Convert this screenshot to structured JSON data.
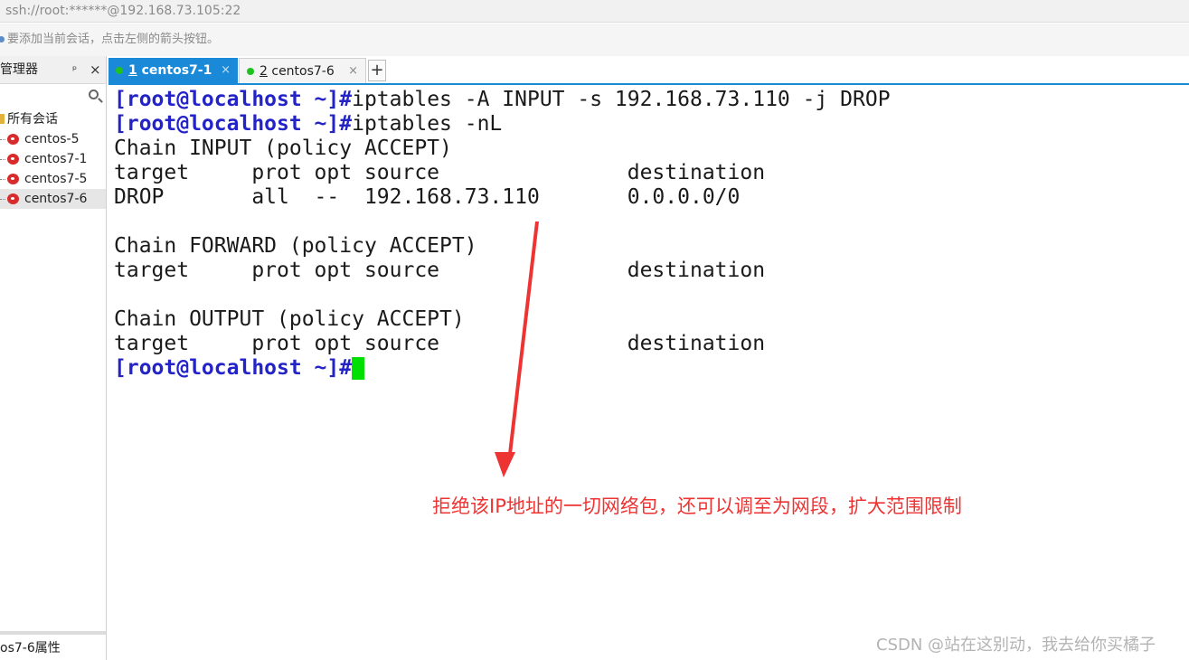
{
  "window": {
    "address": "ssh://root:******@192.168.73.105:22",
    "hint": "要添加当前会话，点击左侧的箭头按钮。"
  },
  "sidebar": {
    "title": "管理器",
    "pin_glyph": "ᵖ",
    "close_glyph": "×",
    "root_label": "所有会话",
    "items": [
      {
        "label": "centos-5"
      },
      {
        "label": "centos7-1"
      },
      {
        "label": "centos7-5"
      },
      {
        "label": "centos7-6"
      }
    ],
    "selected_item": "centos7-6",
    "properties_label": "os7-6属性"
  },
  "tabs": [
    {
      "number": "1",
      "label": " centos7-1",
      "close": "×",
      "active": true
    },
    {
      "number": "2",
      "label": " centos7-6",
      "close": "×",
      "active": false
    }
  ],
  "add_tab_label": "+",
  "terminal": {
    "lines": [
      {
        "prompt": "[root@localhost ~]#",
        "text": "iptables -A INPUT -s 192.168.73.110 -j DROP"
      },
      {
        "prompt": "[root@localhost ~]#",
        "text": "iptables -nL"
      },
      {
        "text": "Chain INPUT (policy ACCEPT)"
      },
      {
        "text": "target     prot opt source               destination"
      },
      {
        "text": "DROP       all  --  192.168.73.110       0.0.0.0/0"
      },
      {
        "text": ""
      },
      {
        "text": "Chain FORWARD (policy ACCEPT)"
      },
      {
        "text": "target     prot opt source               destination"
      },
      {
        "text": ""
      },
      {
        "text": "Chain OUTPUT (policy ACCEPT)"
      },
      {
        "text": "target     prot opt source               destination"
      },
      {
        "prompt": "[root@localhost ~]#",
        "text": ""
      }
    ],
    "prompt_color": "#2323c8",
    "cursor_color": "#00e000"
  },
  "annotation": {
    "text": "拒绝该IP地址的一切网络包，还可以调至为网段，扩大范围限制",
    "color": "#ee3333"
  },
  "watermark": "CSDN @站在这别动，我去给你买橘子",
  "icons": {
    "search": "search-icon",
    "session": "session-icon",
    "folder": "folder-icon",
    "status": "connected-status-icon"
  }
}
